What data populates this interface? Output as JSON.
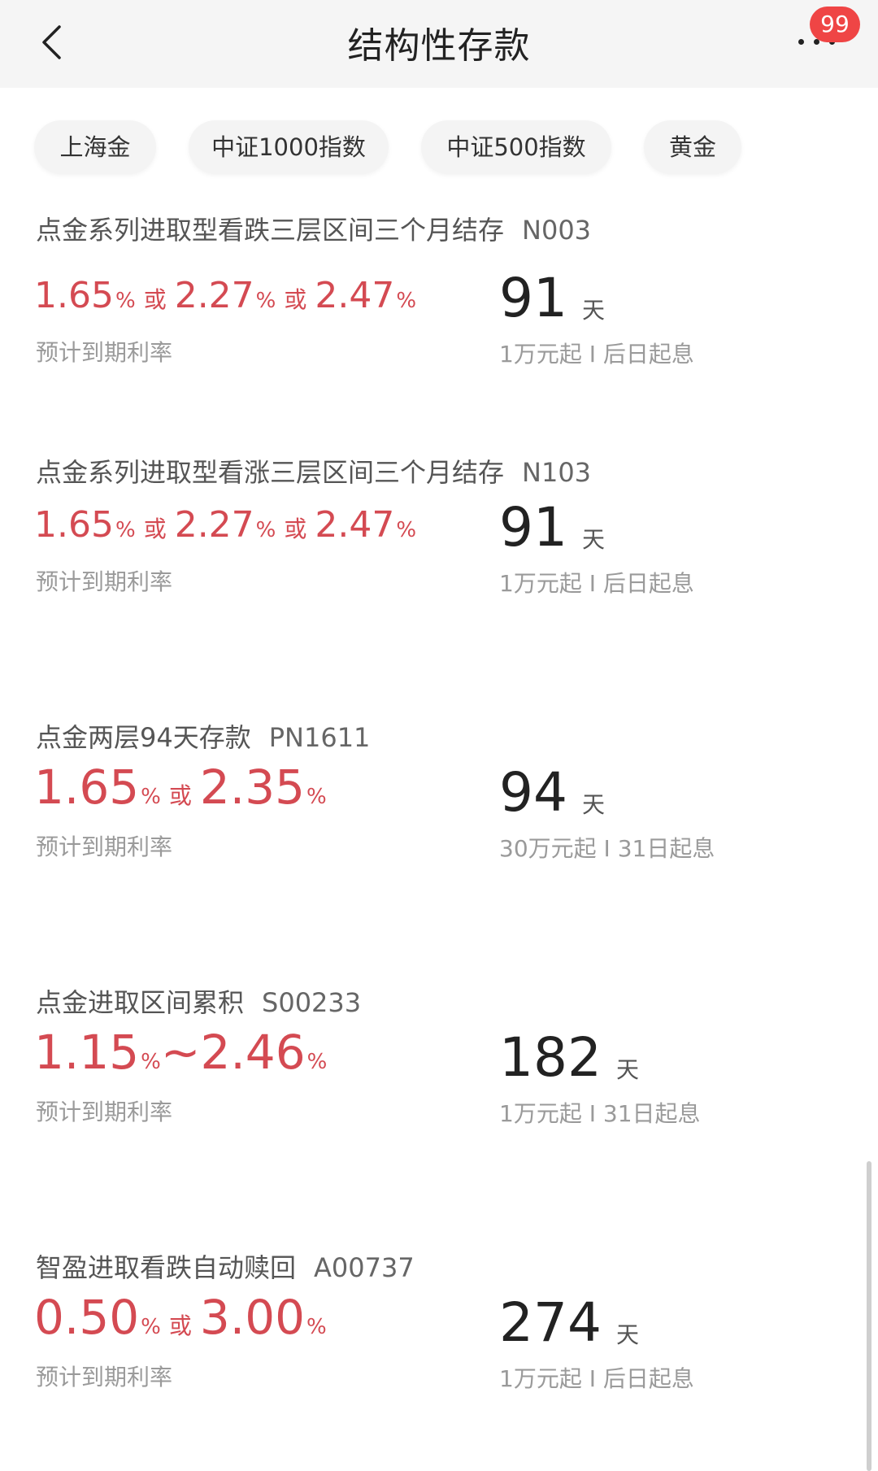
{
  "header": {
    "title": "结构性存款",
    "badge_count": "99"
  },
  "chips": [
    "上海金",
    "中证1000指数",
    "中证500指数",
    "黄金"
  ],
  "rate_label_text": "预计到期利率",
  "day_unit": "天",
  "products": [
    {
      "name": "点金系列进取型看跌三层区间三个月结存",
      "code": "N003",
      "rates": [
        "1.65",
        "2.27",
        "2.47"
      ],
      "rate_style": "or",
      "days": "91",
      "min_and_start": "1万元起 I 后日起息"
    },
    {
      "name": "点金系列进取型看涨三层区间三个月结存",
      "code": "N103",
      "rates": [
        "1.65",
        "2.27",
        "2.47"
      ],
      "rate_style": "or",
      "days": "91",
      "min_and_start": "1万元起 I 后日起息"
    },
    {
      "name": "点金两层94天存款",
      "code": "PN1611",
      "rates": [
        "1.65",
        "2.35"
      ],
      "rate_style": "or",
      "days": "94",
      "min_and_start": "30万元起 I 31日起息"
    },
    {
      "name": "点金进取区间累积",
      "code": "S00233",
      "rates": [
        "1.15",
        "2.46"
      ],
      "rate_style": "range",
      "days": "182",
      "min_and_start": "1万元起 I 31日起息"
    },
    {
      "name": "智盈进取看跌自动赎回",
      "code": "A00737",
      "rates": [
        "0.50",
        "3.00"
      ],
      "rate_style": "or",
      "days": "274",
      "min_and_start": "1万元起 I 后日起息"
    }
  ],
  "text": {
    "pct": "%",
    "or": "或",
    "range_sep": "~"
  },
  "colors": {
    "accent_red": "#d44a52",
    "badge_red": "#ef4545",
    "header_bg": "#f5f5f5"
  },
  "icons": [
    "chevron-left-icon",
    "more-icon"
  ]
}
